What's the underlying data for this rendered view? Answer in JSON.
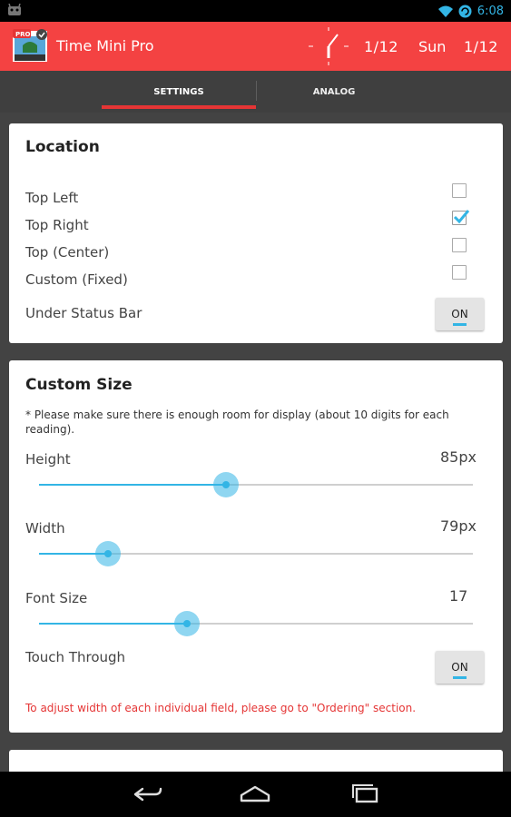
{
  "status_bar": {
    "time": "6:08",
    "left_icon": "android-debug-icon",
    "right_icons": [
      "wifi-icon",
      "sync-icon"
    ]
  },
  "app_bar": {
    "title": "Time Mini Pro",
    "icon": "app-icon",
    "icon_badge": "PRO",
    "clock_date": "1/12",
    "clock_day": "Sun",
    "clock_date_2": "1/12",
    "background": "#f44242"
  },
  "tabs": [
    {
      "label": "SETTINGS",
      "selected": true
    },
    {
      "label": "ANALOG",
      "selected": false
    }
  ],
  "location_card": {
    "title": "Location",
    "options": [
      {
        "label": "Top Left",
        "checked": false
      },
      {
        "label": "Top Right",
        "checked": true
      },
      {
        "label": "Top (Center)",
        "checked": false
      },
      {
        "label": "Custom (Fixed)",
        "checked": false
      }
    ],
    "under_status_bar": {
      "label": "Under Status Bar",
      "toggle": "ON"
    }
  },
  "size_card": {
    "title": "Custom Size",
    "note": "* Please make sure there is enough room for display (about 10 digits for each reading).",
    "sliders": [
      {
        "label": "Height",
        "value": "85px",
        "fraction": 0.43
      },
      {
        "label": "Width",
        "value": "79px",
        "fraction": 0.16
      },
      {
        "label": "Font Size",
        "value": "17",
        "fraction": 0.34
      }
    ],
    "touch_through": {
      "label": "Touch Through",
      "toggle": "ON"
    },
    "warning": "To adjust width of each individual field, please go to \"Ordering\" section."
  },
  "colors": {
    "accent": "#33b5e5",
    "warning": "#e53535",
    "tab_indicator": "#e53535"
  },
  "nav_bar": {
    "buttons": [
      "back-icon",
      "home-icon",
      "recents-icon"
    ]
  }
}
